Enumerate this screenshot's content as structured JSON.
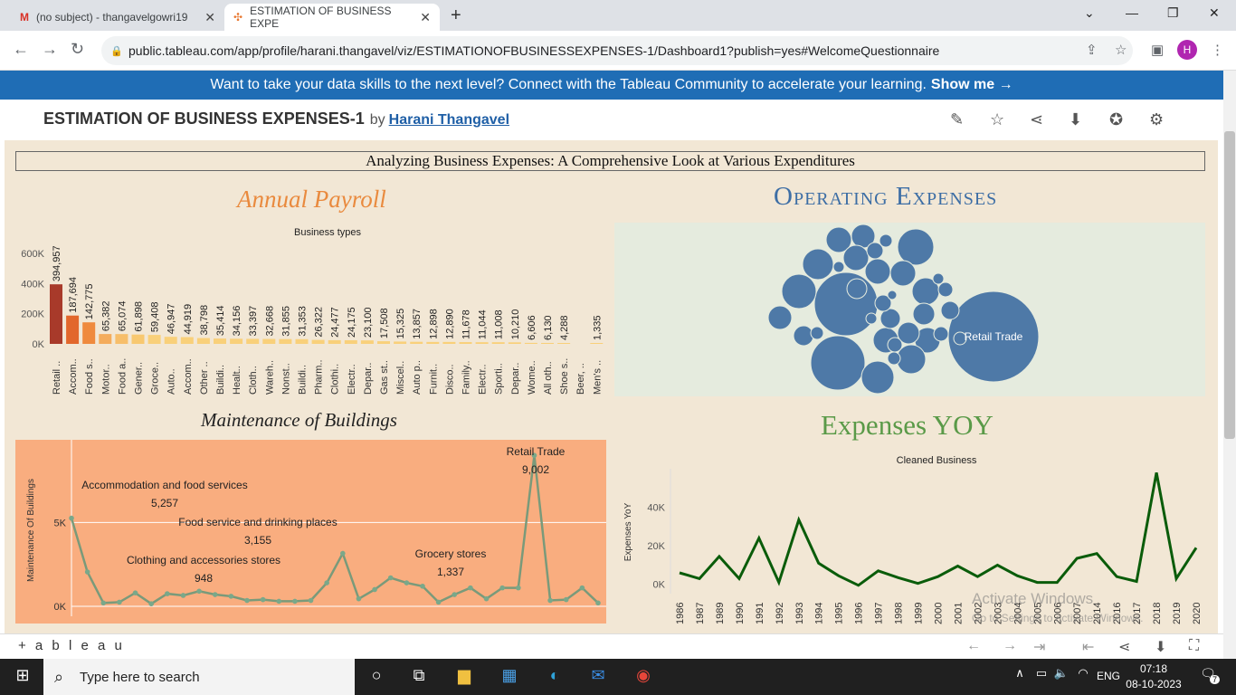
{
  "browser": {
    "tabs": [
      {
        "label": "(no subject) - thangavelgowri19"
      },
      {
        "label": "ESTIMATION OF BUSINESS EXPE"
      }
    ],
    "url": "public.tableau.com/app/profile/harani.thangavel/viz/ESTIMATIONOFBUSINESSEXPENSES-1/Dashboard1?publish=yes#WelcomeQuestionnaire",
    "avatar_letter": "H"
  },
  "banner": {
    "text": "Want to take your data skills to the next level? Connect with the Tableau Community to accelerate your learning.",
    "link": "Show me →"
  },
  "viz_header": {
    "title": "ESTIMATION OF BUSINESS EXPENSES-1",
    "by": "by",
    "author": "Harani Thangavel"
  },
  "dashboard": {
    "title": "Analyzing Business Expenses: A Comprehensive Look at Various Expenditures",
    "payroll_title": "Annual Payroll",
    "operating_title": "Operating Expenses",
    "maintenance_title": "Maintenance of Buildings",
    "yoy_title": "Expenses YOY",
    "bubble_label": "Retail Trade"
  },
  "chart_data": [
    {
      "type": "bar",
      "title": "Business types",
      "categories": [
        "Retail ..",
        "Accom..",
        "Food s..",
        "Motor..",
        "Food a..",
        "Gener..",
        "Groce..",
        "Auto..",
        "Accom..",
        "Other ..",
        "Buildi..",
        "Healt..",
        "Cloth..",
        "Wareh..",
        "Nonst..",
        "Buildi..",
        "Pharm..",
        "Clothi..",
        "Electr..",
        "Depar..",
        "Gas st..",
        "Miscel..",
        "Auto p..",
        "Furnit..",
        "Disco..",
        "Family..",
        "Electr..",
        "Sporti..",
        "Depar..",
        "Wome..",
        "All oth..",
        "Shoe s..",
        "Beer, ..",
        "Men's .."
      ],
      "values": [
        394957,
        187694,
        142775,
        65382,
        65074,
        61898,
        59408,
        46947,
        44919,
        38798,
        35414,
        34156,
        33397,
        32668,
        31855,
        31353,
        26322,
        24477,
        24175,
        23100,
        17508,
        15325,
        13857,
        12898,
        12890,
        11678,
        11044,
        11008,
        10210,
        6606,
        6130,
        4288,
        null,
        1335
      ],
      "value_labels": [
        "394,957",
        "187,694",
        "142,775",
        "65,382",
        "65,074",
        "61,898",
        "59,408",
        "46,947",
        "44,919",
        "38,798",
        "35,414",
        "34,156",
        "33,397",
        "32,668",
        "31,855",
        "31,353",
        "26,322",
        "24,477",
        "24,175",
        "23,100",
        "17,508",
        "15,325",
        "13,857",
        "12,898",
        "12,890",
        "11,678",
        "11,044",
        "11,008",
        "10,210",
        "6,606",
        "6,130",
        "4,288",
        "",
        "1,335"
      ],
      "y_ticks": [
        "0K",
        "200K",
        "400K",
        "600K"
      ],
      "ylim": [
        0,
        600000
      ]
    },
    {
      "type": "scatter",
      "title": "",
      "bubbles": [
        {
          "label": "Retail Trade",
          "value": 100
        },
        {
          "label": "",
          "value": 40
        },
        {
          "label": "",
          "value": 22
        },
        {
          "label": "",
          "value": 10
        }
      ]
    },
    {
      "type": "line",
      "ylabel": "Maintenance Of Buildings",
      "y_ticks": [
        "0K",
        "5K"
      ],
      "ylim": [
        0,
        9500
      ],
      "values": [
        5257,
        2050,
        200,
        250,
        800,
        150,
        750,
        650,
        900,
        700,
        600,
        350,
        400,
        300,
        300,
        350,
        1400,
        3155,
        450,
        1000,
        1700,
        1400,
        1200,
        250,
        700,
        1100,
        450,
        1100,
        1100,
        9002,
        350,
        400,
        1100,
        200
      ],
      "annotations": [
        {
          "label": "Accommodation and food services",
          "value": "5,257"
        },
        {
          "label": "Food service and drinking places",
          "value": "3,155"
        },
        {
          "label": "Clothing and accessories stores",
          "value": "948"
        },
        {
          "label": "Grocery stores",
          "value": "1,337"
        },
        {
          "label": "Retail Trade",
          "value": "9,002"
        }
      ]
    },
    {
      "type": "line",
      "title": "Cleaned Business",
      "ylabel": "Expenses YoY",
      "x": [
        "1986",
        "1987",
        "1989",
        "1990",
        "1991",
        "1992",
        "1993",
        "1994",
        "1995",
        "1996",
        "1997",
        "1998",
        "1999",
        "2000",
        "2001",
        "2002",
        "2003",
        "2004",
        "2005",
        "2006",
        "2007",
        "2014",
        "2016",
        "2017",
        "2018",
        "2019",
        "2020"
      ],
      "values": [
        6000,
        3000,
        14500,
        3000,
        24000,
        1000,
        33500,
        11000,
        4500,
        -500,
        7000,
        3500,
        500,
        4000,
        9500,
        4000,
        10000,
        4500,
        1000,
        1000,
        13500,
        16000,
        4000,
        1500,
        58000,
        3000,
        19000
      ],
      "y_ticks": [
        "0K",
        "20K",
        "40K"
      ],
      "ylim": [
        -2000,
        60000
      ],
      "color": "#0a5c0a"
    }
  ],
  "footer": {
    "logo": "+ a b l e a u"
  },
  "watermark": {
    "line1": "Activate Windows",
    "line2": "Go to Settings to activate Windows."
  },
  "taskbar": {
    "search_placeholder": "Type here to search",
    "lang": "ENG",
    "time": "07:18",
    "date": "08-10-2023",
    "notifications": "7"
  }
}
